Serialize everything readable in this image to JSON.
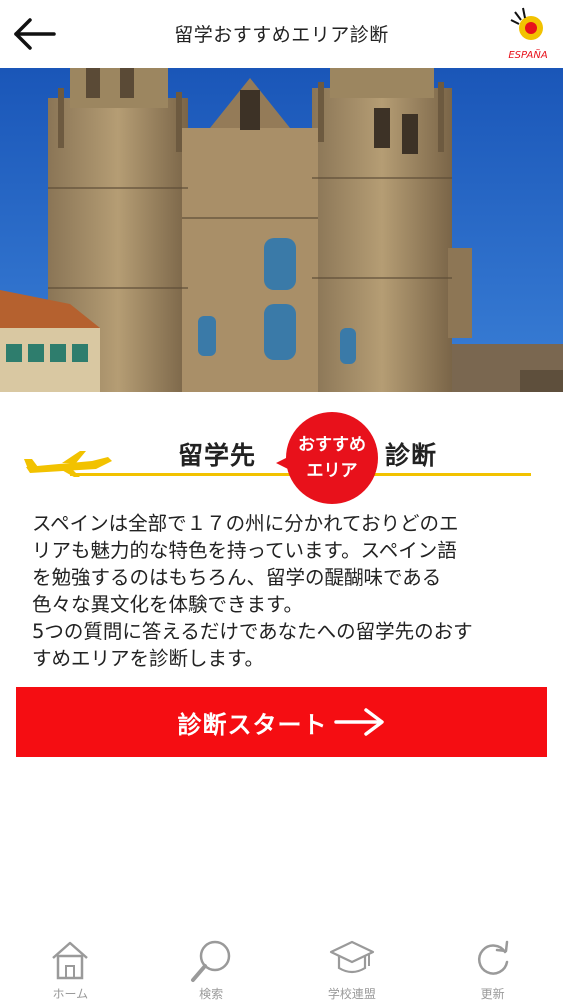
{
  "header": {
    "title": "留学おすすめエリア診断",
    "logo_text": "ESPAÑA"
  },
  "section": {
    "heading_left": "留学先",
    "badge_line1": "おすすめ",
    "badge_line2": "エリア",
    "heading_right": "診断"
  },
  "description": {
    "lines": [
      "スペインは全部で１７の州に分かれておりどのエ",
      "リアも魅力的な特色を持っています。スペイン語",
      "を勉強するのはもちろん、留学の醍醐味である",
      "色々な異文化を体験できます。",
      "5つの質問に答えるだけであなたへの留学先のおす",
      "すめエリアを診断します。"
    ]
  },
  "cta": {
    "label": "診断スタート"
  },
  "tabbar": {
    "items": [
      {
        "label": "ホーム",
        "icon": "home-icon"
      },
      {
        "label": "検索",
        "icon": "search-icon"
      },
      {
        "label": "学校連盟",
        "icon": "graduation-cap-icon"
      },
      {
        "label": "更新",
        "icon": "refresh-icon"
      }
    ]
  },
  "colors": {
    "accent_red": "#f50d12",
    "badge_red": "#e8111b",
    "accent_yellow": "#f2c200",
    "tab_gray": "#9a9a9a"
  }
}
